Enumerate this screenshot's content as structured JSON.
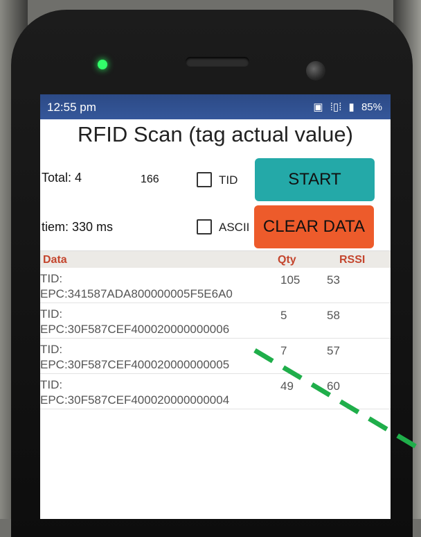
{
  "status": {
    "time": "12:55 pm",
    "nfc_icon": "nfc-icon",
    "vibrate_icon": "vibrate-icon",
    "battery_icon": "battery-icon",
    "battery": "85%"
  },
  "title": "RFID Scan (tag actual value)",
  "stats": {
    "total_label": "Total: 4",
    "count": "166",
    "time_label": "tiem: 330 ms"
  },
  "options": {
    "tid_label": "TID",
    "ascii_label": "ASCII"
  },
  "buttons": {
    "start": "START",
    "clear": "CLEAR DATA"
  },
  "table": {
    "headers": {
      "data": "Data",
      "qty": "Qty",
      "rssi": "RSSI"
    },
    "rows": [
      {
        "tid": "TID:",
        "epc": "EPC:341587ADA800000005F5E6A0",
        "qty": "105",
        "rssi": "53"
      },
      {
        "tid": "TID:",
        "epc": "EPC:30F587CEF400020000000006",
        "qty": "5",
        "rssi": "58"
      },
      {
        "tid": "TID:",
        "epc": "EPC:30F587CEF400020000000005",
        "qty": "7",
        "rssi": "57"
      },
      {
        "tid": "TID:",
        "epc": "EPC:30F587CEF400020000000004",
        "qty": "49",
        "rssi": "60"
      }
    ]
  },
  "colors": {
    "start": "#24a9a8",
    "clear": "#ed5b2b",
    "header_text": "#c4452d",
    "annotation": "#1fae4a"
  }
}
